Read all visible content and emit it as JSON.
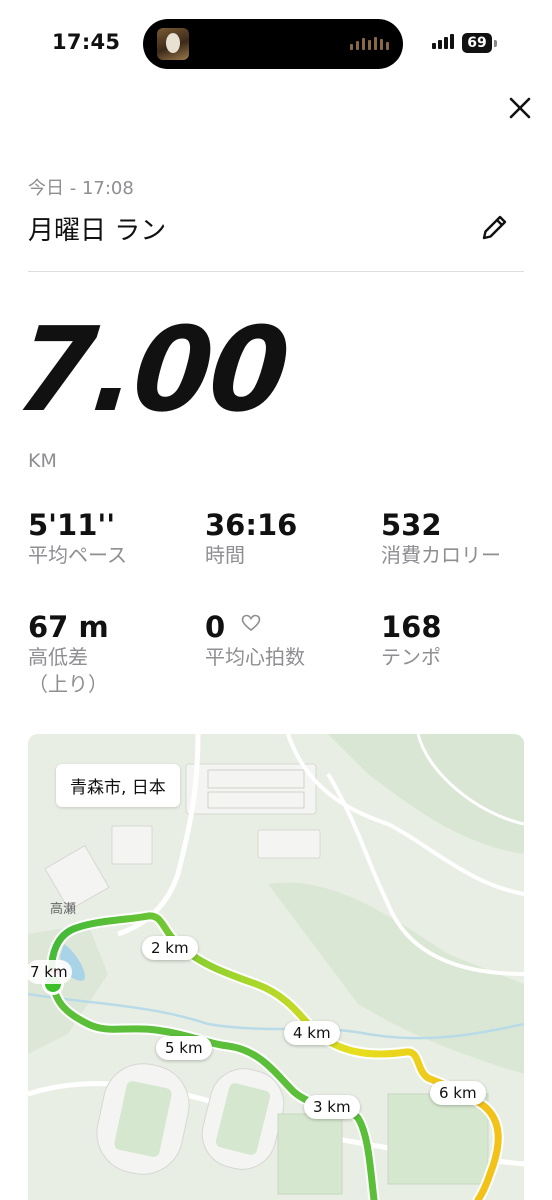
{
  "status_bar": {
    "time": "17:45",
    "battery": "69"
  },
  "header": {
    "date_time": "今日 - 17:08",
    "title": "月曜日 ラン"
  },
  "summary": {
    "distance": "7.00",
    "unit": "KM"
  },
  "stats": [
    {
      "value": "5'11''",
      "label": "平均ペース"
    },
    {
      "value": "36:16",
      "label": "時間"
    },
    {
      "value": "532",
      "label": "消費カロリー"
    },
    {
      "value": "67 m",
      "label": "高低差",
      "label_sub": "（上り）"
    },
    {
      "value": "0",
      "label": "平均心拍数"
    },
    {
      "value": "168",
      "label": "テンポ"
    }
  ],
  "map": {
    "location": "青森市, 日本",
    "area_label": "高瀬",
    "km_markers": [
      "2 km",
      "4 km",
      "5 km",
      "3 km",
      "6 km",
      "7 km"
    ],
    "route_colors": {
      "start": "#3cb73a",
      "mid": "#a5d62c",
      "end": "#f2c219"
    }
  },
  "icons": {
    "close": "close-icon",
    "edit": "pencil-icon",
    "heart": "heart-outline-icon"
  }
}
